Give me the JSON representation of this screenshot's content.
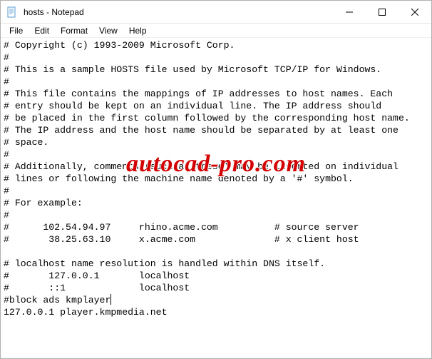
{
  "window": {
    "title": "hosts - Notepad"
  },
  "menu": {
    "file": "File",
    "edit": "Edit",
    "format": "Format",
    "view": "View",
    "help": "Help"
  },
  "content": {
    "l1": "# Copyright (c) 1993-2009 Microsoft Corp.",
    "l2": "#",
    "l3": "# This is a sample HOSTS file used by Microsoft TCP/IP for Windows.",
    "l4": "#",
    "l5": "# This file contains the mappings of IP addresses to host names. Each",
    "l6": "# entry should be kept on an individual line. The IP address should",
    "l7": "# be placed in the first column followed by the corresponding host name.",
    "l8": "# The IP address and the host name should be separated by at least one",
    "l9": "# space.",
    "l10": "#",
    "l11": "# Additionally, comments (such as these) may be inserted on individual",
    "l12": "# lines or following the machine name denoted by a '#' symbol.",
    "l13": "#",
    "l14": "# For example:",
    "l15": "#",
    "l16": "#      102.54.94.97     rhino.acme.com          # source server",
    "l17": "#       38.25.63.10     x.acme.com              # x client host",
    "l18": "",
    "l19": "# localhost name resolution is handled within DNS itself.",
    "l20": "#       127.0.0.1       localhost",
    "l21": "#       ::1             localhost",
    "l22": "#block ads kmplayer",
    "l23": "127.0.0.1 player.kmpmedia.net"
  },
  "watermark": "autocad-pro.com"
}
